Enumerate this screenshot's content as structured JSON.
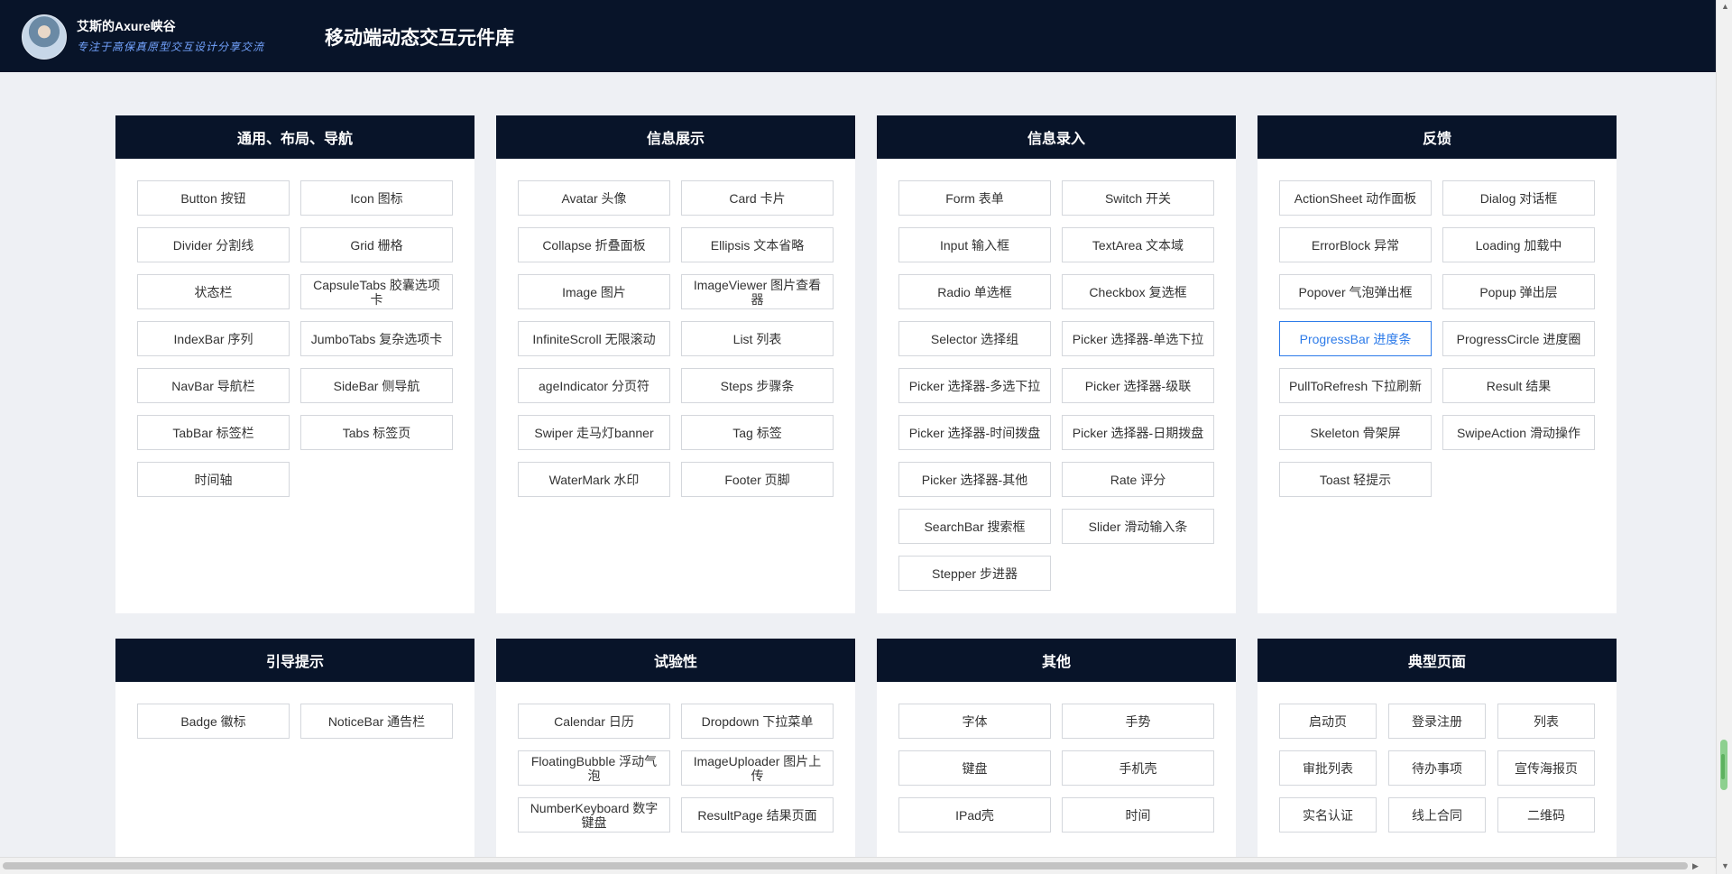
{
  "header": {
    "brand_name": "艾斯的Axure峡谷",
    "brand_slogan": "专注于高保真原型交互设计分享交流",
    "app_title": "移动端动态交互元件库"
  },
  "sections": [
    {
      "title": "通用、布局、导航",
      "items": [
        "Button 按钮",
        "Icon 图标",
        "Divider 分割线",
        "Grid 栅格",
        "状态栏",
        "CapsuleTabs 胶囊选项卡",
        "IndexBar 序列",
        "JumboTabs 复杂选项卡",
        "NavBar 导航栏",
        "SideBar 侧导航",
        "TabBar 标签栏",
        "Tabs 标签页",
        "时间轴"
      ]
    },
    {
      "title": "信息展示",
      "items": [
        "Avatar 头像",
        "Card 卡片",
        "Collapse 折叠面板",
        "Ellipsis 文本省略",
        "Image 图片",
        "ImageViewer 图片查看器",
        "InfiniteScroll 无限滚动",
        "List 列表",
        "ageIndicator 分页符",
        "Steps 步骤条",
        "Swiper 走马灯banner",
        "Tag 标签",
        "WaterMark 水印",
        "Footer 页脚"
      ]
    },
    {
      "title": "信息录入",
      "items": [
        "Form 表单",
        "Switch 开关",
        "Input 输入框",
        "TextArea 文本域",
        "Radio 单选框",
        "Checkbox 复选框",
        "Selector 选择组",
        "Picker 选择器-单选下拉",
        "Picker 选择器-多选下拉",
        "Picker 选择器-级联",
        "Picker 选择器-时间拨盘",
        "Picker 选择器-日期拨盘",
        "Picker 选择器-其他",
        "Rate 评分",
        "SearchBar 搜索框",
        "Slider 滑动输入条",
        "Stepper 步进器"
      ]
    },
    {
      "title": "反馈",
      "items": [
        "ActionSheet 动作面板",
        "Dialog 对话框",
        "ErrorBlock 异常",
        "Loading 加载中",
        "Popover 气泡弹出框",
        "Popup 弹出层",
        "ProgressBar 进度条",
        "ProgressCircle 进度圈",
        "PullToRefresh 下拉刷新",
        "Result 结果",
        "Skeleton 骨架屏",
        "SwipeAction 滑动操作",
        "Toast 轻提示"
      ]
    },
    {
      "title": "引导提示",
      "items": [
        "Badge 徽标",
        "NoticeBar 通告栏"
      ]
    },
    {
      "title": "试验性",
      "items": [
        "Calendar 日历",
        "Dropdown 下拉菜单",
        "FloatingBubble 浮动气泡",
        "ImageUploader 图片上传",
        "NumberKeyboard 数字键盘",
        "ResultPage 结果页面"
      ]
    },
    {
      "title": "其他",
      "items": [
        "字体",
        "手势",
        "键盘",
        "手机壳",
        "IPad壳",
        "时间"
      ]
    },
    {
      "title": "典型页面",
      "items": [
        "启动页",
        "登录注册",
        "列表",
        "审批列表",
        "待办事项",
        "宣传海报页",
        "实名认证",
        "线上合同",
        "二维码"
      ]
    }
  ],
  "active_item": "ProgressBar 进度条"
}
